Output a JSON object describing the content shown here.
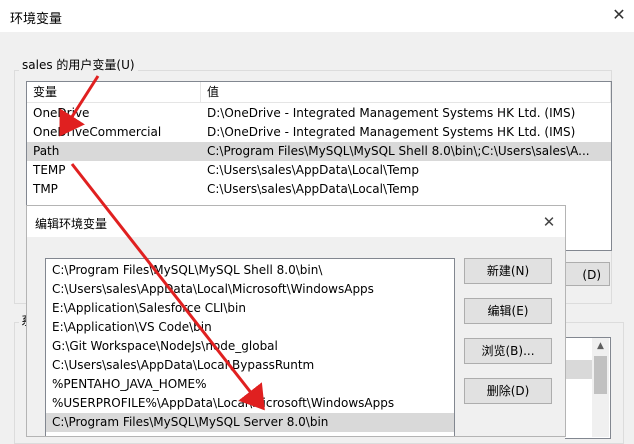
{
  "outer": {
    "title": "环境变量",
    "user_group_label": "sales 的用户变量(U)",
    "columns": [
      "变量",
      "值"
    ],
    "user_vars": [
      {
        "name": "OneDrive",
        "value": "D:\\OneDrive - Integrated Management Systems HK Ltd. (IMS)"
      },
      {
        "name": "OneDriveCommercial",
        "value": "D:\\OneDrive - Integrated Management Systems HK Ltd. (IMS)"
      },
      {
        "name": "Path",
        "value": "C:\\Program Files\\MySQL\\MySQL Shell 8.0\\bin\\;C:\\Users\\sales\\A..."
      },
      {
        "name": "TEMP",
        "value": "C:\\Users\\sales\\AppData\\Local\\Temp"
      },
      {
        "name": "TMP",
        "value": "C:\\Users\\sales\\AppData\\Local\\Temp"
      }
    ],
    "partial_button_label": "(D)",
    "sys_group_label_partial": "系"
  },
  "inner": {
    "title": "编辑环境变量",
    "paths": [
      "C:\\Program Files\\MySQL\\MySQL Shell 8.0\\bin\\",
      "C:\\Users\\sales\\AppData\\Local\\Microsoft\\WindowsApps",
      "E:\\Application\\Salesforce CLI\\bin",
      "E:\\Application\\VS Code\\bin",
      "G:\\Git Workspace\\NodeJs\\node_global",
      "C:\\Users\\sales\\AppData\\Local\\BypassRuntm",
      "%PENTAHO_JAVA_HOME%",
      "%USERPROFILE%\\AppData\\Local\\Microsoft\\WindowsApps",
      "C:\\Program Files\\MySQL\\MySQL Server 8.0\\bin"
    ],
    "buttons": {
      "new": "新建(N)",
      "edit": "编辑(E)",
      "browse": "浏览(B)...",
      "delete": "删除(D)"
    }
  },
  "colors": {
    "arrow": "#e02020",
    "selection": "#d9d9d9"
  },
  "icons": {
    "close": "close-icon",
    "scroll_up": "chevron-up-icon"
  }
}
